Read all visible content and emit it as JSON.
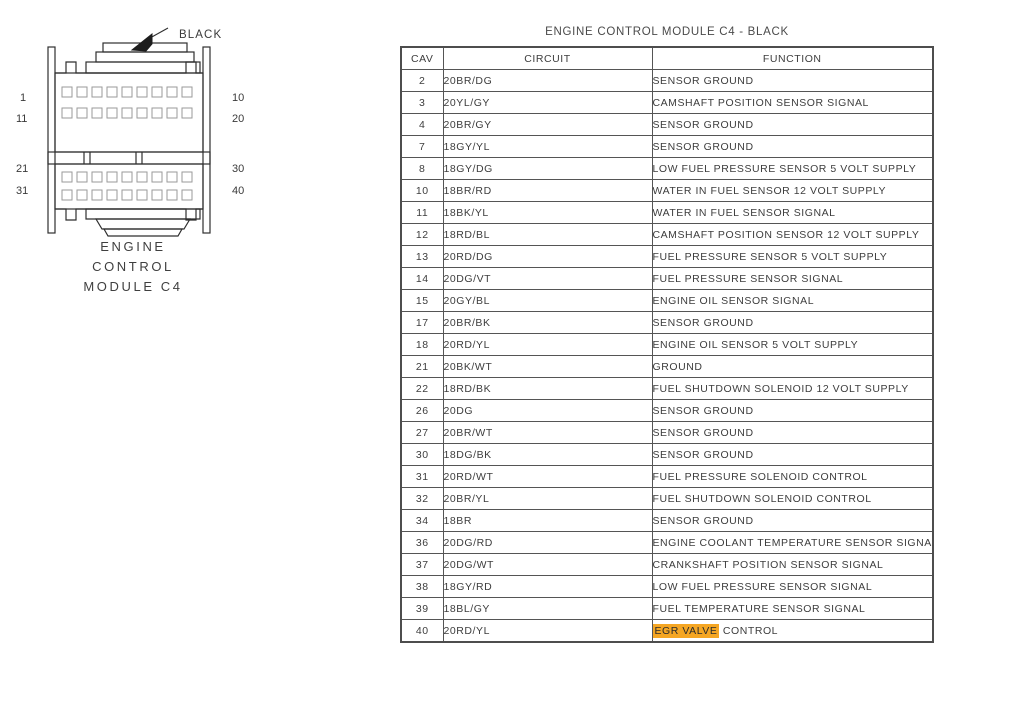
{
  "diagram": {
    "callout_label": "BLACK",
    "caption_lines": [
      "ENGINE",
      "CONTROL",
      "MODULE C4"
    ],
    "pin_labels": {
      "top_left": "1",
      "top_right": "10",
      "second_left": "11",
      "second_right": "20",
      "third_left": "21",
      "third_right": "30",
      "bottom_left": "31",
      "bottom_right": "40"
    },
    "pins_per_row": 10,
    "rows": 4
  },
  "table": {
    "title": "ENGINE CONTROL MODULE C4 - BLACK",
    "columns": [
      "CAV",
      "CIRCUIT",
      "FUNCTION"
    ],
    "highlight_color": "#F5A623",
    "rows": [
      {
        "cav": "2",
        "circuit": "20BR/DG",
        "function": "SENSOR GROUND"
      },
      {
        "cav": "3",
        "circuit": "20YL/GY",
        "function": "CAMSHAFT POSITION SENSOR SIGNAL"
      },
      {
        "cav": "4",
        "circuit": "20BR/GY",
        "function": "SENSOR GROUND"
      },
      {
        "cav": "7",
        "circuit": "18GY/YL",
        "function": "SENSOR GROUND"
      },
      {
        "cav": "8",
        "circuit": "18GY/DG",
        "function": "LOW FUEL PRESSURE SENSOR 5 VOLT SUPPLY"
      },
      {
        "cav": "10",
        "circuit": "18BR/RD",
        "function": "WATER IN FUEL SENSOR 12 VOLT SUPPLY"
      },
      {
        "cav": "11",
        "circuit": "18BK/YL",
        "function": "WATER IN FUEL SENSOR SIGNAL"
      },
      {
        "cav": "12",
        "circuit": "18RD/BL",
        "function": "CAMSHAFT POSITION SENSOR 12 VOLT SUPPLY"
      },
      {
        "cav": "13",
        "circuit": "20RD/DG",
        "function": "FUEL PRESSURE SENSOR 5 VOLT SUPPLY"
      },
      {
        "cav": "14",
        "circuit": "20DG/VT",
        "function": "FUEL PRESSURE SENSOR SIGNAL"
      },
      {
        "cav": "15",
        "circuit": "20GY/BL",
        "function": "ENGINE OIL SENSOR SIGNAL"
      },
      {
        "cav": "17",
        "circuit": "20BR/BK",
        "function": "SENSOR GROUND"
      },
      {
        "cav": "18",
        "circuit": "20RD/YL",
        "function": "ENGINE OIL SENSOR 5 VOLT SUPPLY"
      },
      {
        "cav": "21",
        "circuit": "20BK/WT",
        "function": "GROUND"
      },
      {
        "cav": "22",
        "circuit": "18RD/BK",
        "function": "FUEL SHUTDOWN SOLENOID 12 VOLT SUPPLY"
      },
      {
        "cav": "26",
        "circuit": "20DG",
        "function": "SENSOR GROUND"
      },
      {
        "cav": "27",
        "circuit": "20BR/WT",
        "function": "SENSOR GROUND"
      },
      {
        "cav": "30",
        "circuit": "18DG/BK",
        "function": "SENSOR GROUND"
      },
      {
        "cav": "31",
        "circuit": "20RD/WT",
        "function": "FUEL PRESSURE SOLENOID CONTROL"
      },
      {
        "cav": "32",
        "circuit": "20BR/YL",
        "function": "FUEL SHUTDOWN SOLENOID CONTROL"
      },
      {
        "cav": "34",
        "circuit": "18BR",
        "function": "SENSOR GROUND"
      },
      {
        "cav": "36",
        "circuit": "20DG/RD",
        "function": "ENGINE COOLANT TEMPERATURE SENSOR SIGNAL"
      },
      {
        "cav": "37",
        "circuit": "20DG/WT",
        "function": "CRANKSHAFT POSITION SENSOR SIGNAL"
      },
      {
        "cav": "38",
        "circuit": "18GY/RD",
        "function": "LOW FUEL PRESSURE SENSOR SIGNAL"
      },
      {
        "cav": "39",
        "circuit": "18BL/GY",
        "function": "FUEL TEMPERATURE SENSOR SIGNAL"
      },
      {
        "cav": "40",
        "circuit": "20RD/YL",
        "function": "EGR VALVE CONTROL",
        "highlight": "EGR VALVE",
        "rest": " CONTROL"
      }
    ]
  }
}
